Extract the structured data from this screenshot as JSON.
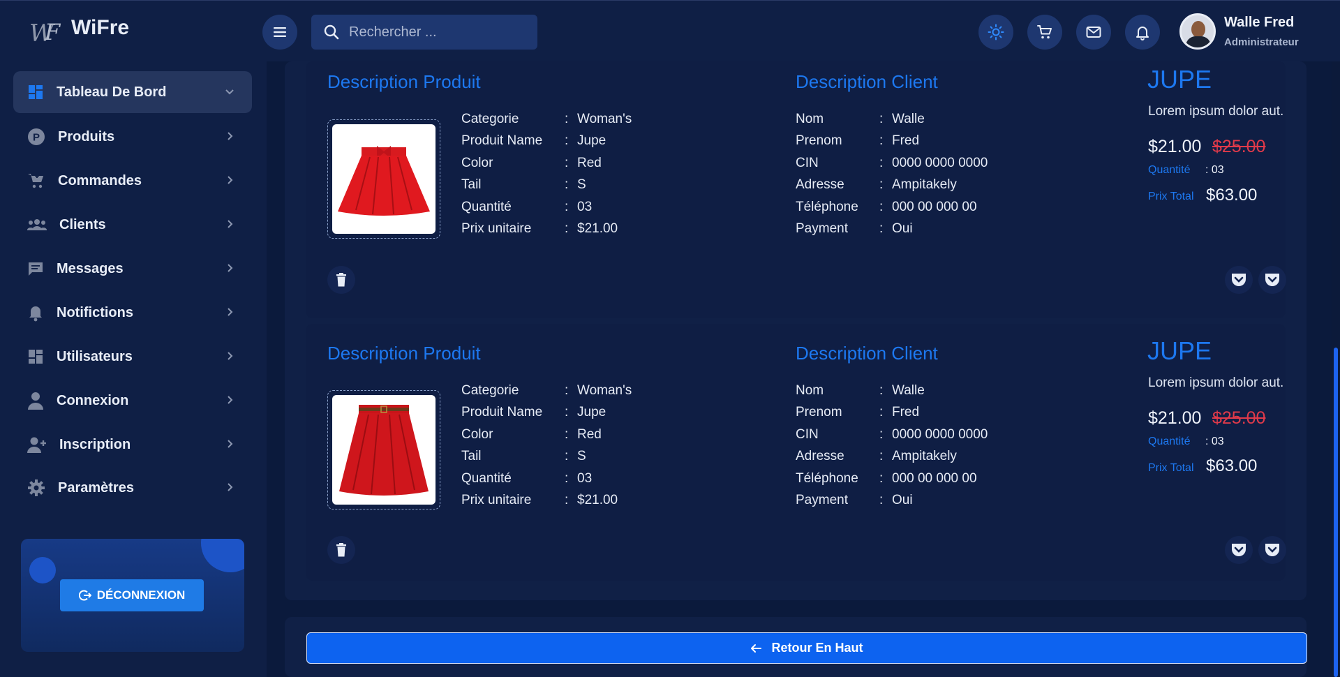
{
  "brand": {
    "logo_text": "WiFre"
  },
  "search": {
    "placeholder": "Rechercher ..."
  },
  "user": {
    "name": "Walle Fred",
    "role": "Administrateur"
  },
  "sidebar": {
    "items": [
      {
        "label": "Tableau De Bord",
        "icon": "dashboard-icon",
        "active": true
      },
      {
        "label": "Produits",
        "icon": "product-p-icon"
      },
      {
        "label": "Commandes",
        "icon": "cart-icon"
      },
      {
        "label": "Clients",
        "icon": "clients-icon"
      },
      {
        "label": "Messages",
        "icon": "message-icon"
      },
      {
        "label": "Notifictions",
        "icon": "bell-icon"
      },
      {
        "label": "Utilisateurs",
        "icon": "users-grid-icon"
      },
      {
        "label": "Connexion",
        "icon": "person-icon"
      },
      {
        "label": "Inscription",
        "icon": "person-add-icon"
      },
      {
        "label": "Paramètres",
        "icon": "gear-icon"
      }
    ],
    "logout_label": "DÉCONNEXION"
  },
  "orders": [
    {
      "product_section_title": "Description Produit",
      "client_section_title": "Description Client",
      "product": {
        "rows": [
          {
            "k": "Categorie",
            "v": "Woman's"
          },
          {
            "k": "Produit Name",
            "v": "Jupe"
          },
          {
            "k": "Color",
            "v": "Red"
          },
          {
            "k": "Tail",
            "v": "S"
          },
          {
            "k": "Quantité",
            "v": "03"
          },
          {
            "k": "Prix unitaire",
            "v": "$21.00"
          }
        ]
      },
      "client": {
        "rows": [
          {
            "k": "Nom",
            "v": "Walle"
          },
          {
            "k": "Prenom",
            "v": "Fred"
          },
          {
            "k": "CIN",
            "v": "0000 0000 0000"
          },
          {
            "k": "Adresse",
            "v": "Ampitakely"
          },
          {
            "k": "Téléphone",
            "v": "000 00 000 00"
          },
          {
            "k": "Payment",
            "v": "Oui"
          }
        ]
      },
      "summary": {
        "title": "JUPE",
        "description": "Lorem ipsum dolor aut.",
        "price": "$21.00",
        "old_price": "$25.00",
        "qty_label": "Quantité",
        "qty_value": ": 03",
        "total_label": "Prix Total",
        "total_value": "$63.00"
      }
    },
    {
      "product_section_title": "Description Produit",
      "client_section_title": "Description Client",
      "product": {
        "rows": [
          {
            "k": "Categorie",
            "v": "Woman's"
          },
          {
            "k": "Produit Name",
            "v": "Jupe"
          },
          {
            "k": "Color",
            "v": "Red"
          },
          {
            "k": "Tail",
            "v": "S"
          },
          {
            "k": "Quantité",
            "v": "03"
          },
          {
            "k": "Prix unitaire",
            "v": "$21.00"
          }
        ]
      },
      "client": {
        "rows": [
          {
            "k": "Nom",
            "v": "Walle"
          },
          {
            "k": "Prenom",
            "v": "Fred"
          },
          {
            "k": "CIN",
            "v": "0000 0000 0000"
          },
          {
            "k": "Adresse",
            "v": "Ampitakely"
          },
          {
            "k": "Téléphone",
            "v": "000 00 000 00"
          },
          {
            "k": "Payment",
            "v": "Oui"
          }
        ]
      },
      "summary": {
        "title": "JUPE",
        "description": "Lorem ipsum dolor aut.",
        "price": "$21.00",
        "old_price": "$25.00",
        "qty_label": "Quantité",
        "qty_value": ": 03",
        "total_label": "Prix Total",
        "total_value": "$63.00"
      }
    }
  ],
  "footer": {
    "back_to_top_label": "Retour En Haut"
  },
  "colors": {
    "accent": "#1d78f0",
    "button": "#0d63f0",
    "strike": "#e03a4a",
    "background": "#0b1a3c"
  }
}
